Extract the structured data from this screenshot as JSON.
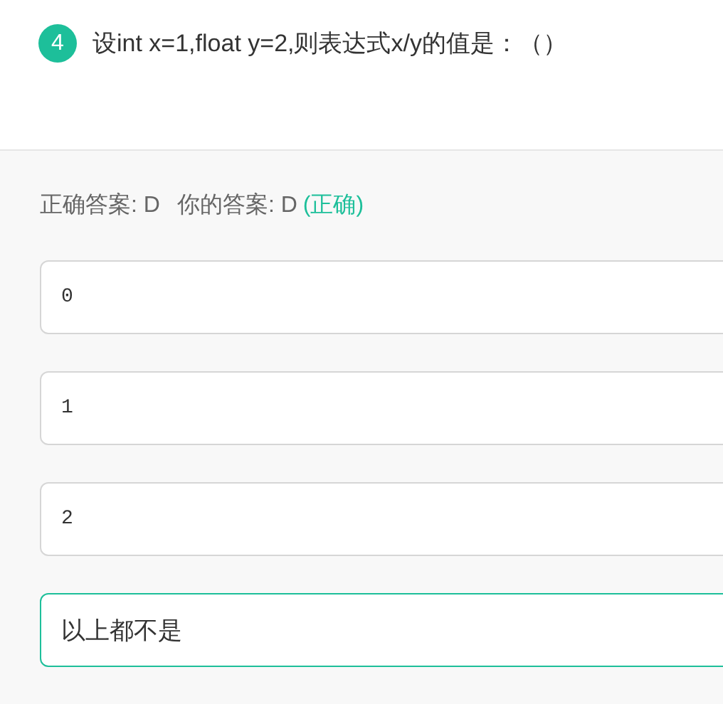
{
  "question": {
    "number": "4",
    "text": "设int x=1,float y=2,则表达式x/y的值是：（）"
  },
  "result": {
    "correct_label": "正确答案: D",
    "your_label": "你的答案: D",
    "verdict": "(正确)"
  },
  "options": [
    {
      "text": "0",
      "kind": "code",
      "selected": false
    },
    {
      "text": "1",
      "kind": "code",
      "selected": false
    },
    {
      "text": "2",
      "kind": "code",
      "selected": false
    },
    {
      "text": "以上都不是",
      "kind": "plain",
      "selected": true
    }
  ]
}
